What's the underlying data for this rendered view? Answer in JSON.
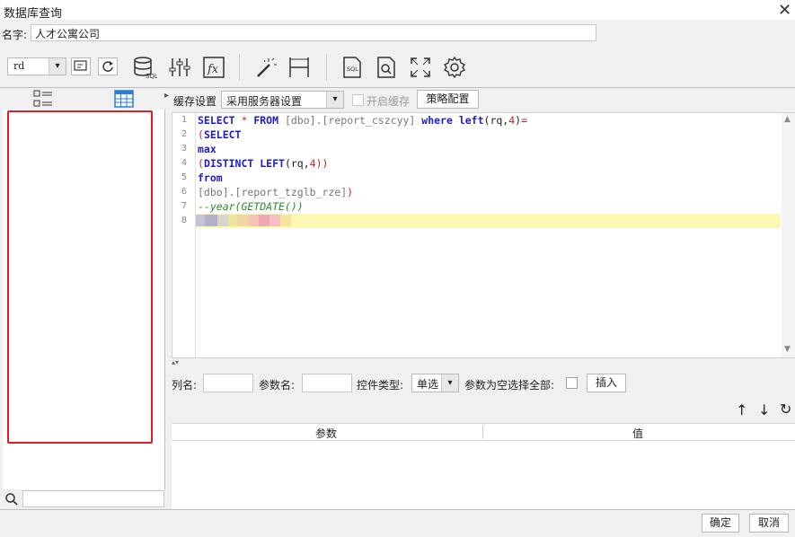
{
  "window": {
    "title": "数据库查询",
    "close": "✕"
  },
  "name_field": {
    "label": "名字:",
    "value": "人才公寓公司"
  },
  "toolbar": {
    "datasource_value": "rd",
    "dropdown_arrow": "▾"
  },
  "left_panel": {
    "tab1_icon": "list-icon",
    "tab2_icon": "table-icon"
  },
  "cache": {
    "label": "缓存设置",
    "select_value": "采用服务器设置",
    "enable_label": "开启缓存",
    "strategy_button": "策略配置"
  },
  "editor": {
    "line_numbers": [
      "1",
      "2",
      "3",
      "4",
      "5",
      "6",
      "7",
      "8"
    ],
    "lines": [
      [
        [
          "kw",
          "SELECT "
        ],
        [
          "red",
          "* "
        ],
        [
          "kw",
          "FROM "
        ],
        [
          "gray",
          "[dbo].[report_cszcyy] "
        ],
        [
          "kw",
          "where "
        ],
        [
          "kw",
          "left"
        ],
        [
          "",
          "(rq,"
        ],
        [
          "red",
          "4"
        ],
        [
          "",
          ")"
        ],
        [
          "red",
          "="
        ]
      ],
      [
        [
          "red",
          "("
        ],
        [
          "kw",
          "SELECT"
        ]
      ],
      [
        [
          "kw",
          "max"
        ]
      ],
      [
        [
          "red",
          "("
        ],
        [
          "kw",
          "DISTINCT "
        ],
        [
          "kw",
          "LEFT"
        ],
        [
          "",
          "(rq,"
        ],
        [
          "red",
          "4"
        ],
        [
          "red",
          "))"
        ]
      ],
      [
        [
          "kw",
          "from"
        ]
      ],
      [
        [
          "gray",
          "[dbo].[report_tzglb_rze]"
        ],
        [
          "red",
          ")"
        ]
      ],
      [
        [
          "cmt",
          "--year(GETDATE())"
        ]
      ],
      [
        [
          "",
          ""
        ]
      ]
    ],
    "highlight_colors": [
      "#c4c4d4",
      "#b0b0c8",
      "#d6d6cc",
      "#eee2a0",
      "#f0d6a0",
      "#f5c4b0",
      "#f0a8b0",
      "#f4c0c0",
      "#f7e4a0"
    ]
  },
  "params": {
    "col_label": "列名:",
    "param_label": "参数名:",
    "widget_label": "控件类型:",
    "widget_value": "单选",
    "empty_all_label": "参数为空选择全部:",
    "insert_button": "插入"
  },
  "table": {
    "headers": [
      "参数",
      "值"
    ]
  },
  "arrows": {
    "up": "↑",
    "down": "↓",
    "refresh": "↻"
  },
  "footer": {
    "ok": "确定",
    "cancel": "取消"
  }
}
